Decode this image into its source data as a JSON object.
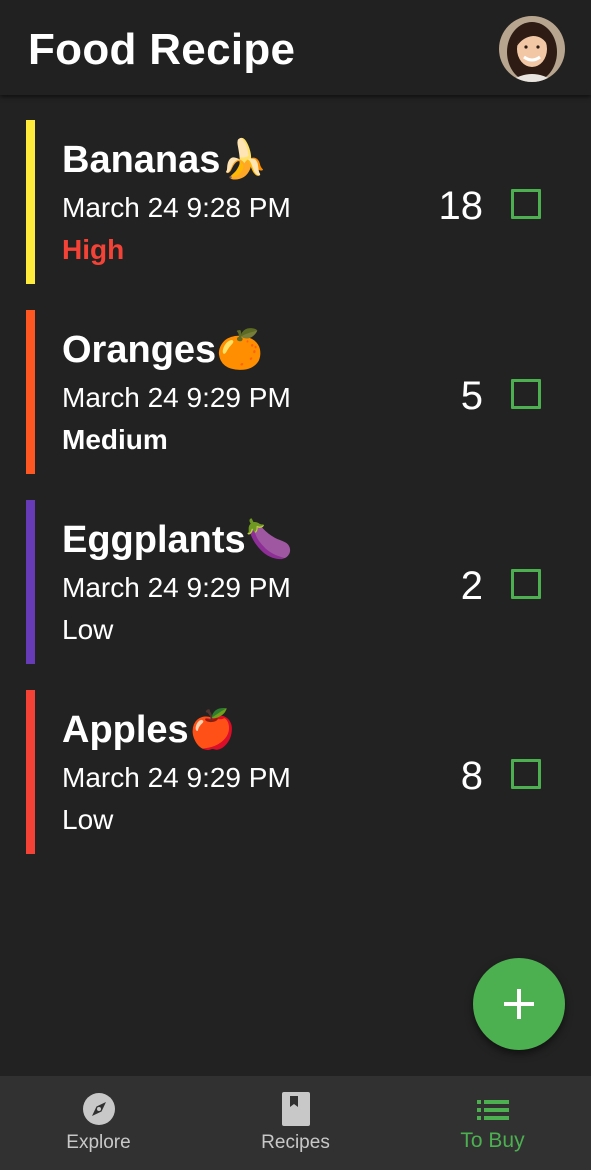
{
  "app_bar": {
    "title": "Food Recipe"
  },
  "items": [
    {
      "name": "Bananas",
      "emoji": "🍌",
      "date": "March 24 9:28 PM",
      "priority": "High",
      "quantity": "18",
      "checked": false,
      "bar_color": "#ffeb3b",
      "priority_color": "#f44336"
    },
    {
      "name": "Oranges",
      "emoji": "🍊",
      "date": "March 24 9:29 PM",
      "priority": "Medium",
      "quantity": "5",
      "checked": false,
      "bar_color": "#ff5722",
      "priority_color": "#ffffff"
    },
    {
      "name": "Eggplants",
      "emoji": "🍆",
      "date": "March 24 9:29 PM",
      "priority": "Low",
      "quantity": "2",
      "checked": false,
      "bar_color": "#673ab7",
      "priority_color": "#ffffff"
    },
    {
      "name": "Apples",
      "emoji": "🍎",
      "date": "March 24 9:29 PM",
      "priority": "Low",
      "quantity": "8",
      "checked": false,
      "bar_color": "#f44336",
      "priority_color": "#ffffff"
    }
  ],
  "fab": {
    "icon": "add-icon",
    "color": "#4caf50"
  },
  "bottom_nav": {
    "items": [
      {
        "label": "Explore",
        "icon": "compass-icon",
        "active": false
      },
      {
        "label": "Recipes",
        "icon": "book-icon",
        "active": false
      },
      {
        "label": "To Buy",
        "icon": "list-icon",
        "active": true
      }
    ],
    "active_color": "#4caf50",
    "inactive_color": "#c8c8c8"
  },
  "colors": {
    "background": "#222222",
    "app_bar": "#212121",
    "bottom_nav": "#313131",
    "accent": "#4caf50"
  }
}
